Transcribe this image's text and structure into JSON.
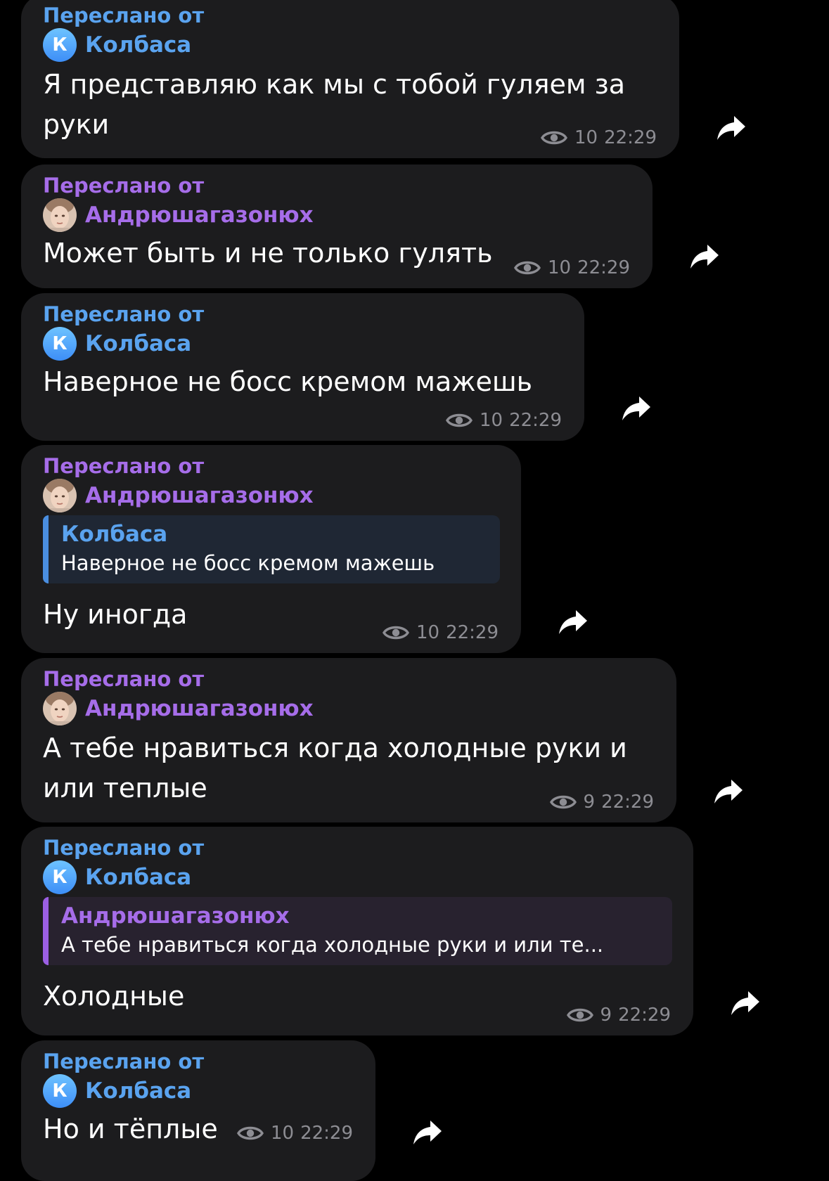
{
  "colors": {
    "background": "#000000",
    "bubble": "#1c1c1e",
    "blue_name": "#5aa3ef",
    "purple_name": "#a66de9",
    "meta": "#8d8d93"
  },
  "messages": [
    {
      "forward_label": "Переслано от",
      "sender": "Колбаса",
      "avatar_letter": "К",
      "text_lines": [
        "Я представляю как мы с тобой гуляем за",
        "руки"
      ],
      "views": "10",
      "time": "22:29"
    },
    {
      "forward_label": "Переслано от",
      "sender": "Андрюшагазонюх",
      "text_lines": [
        "Может быть и не только гулять"
      ],
      "views": "10",
      "time": "22:29"
    },
    {
      "forward_label": "Переслано от",
      "sender": "Колбаса",
      "avatar_letter": "К",
      "text_lines": [
        "Наверное не босс кремом мажешь"
      ],
      "views": "10",
      "time": "22:29"
    },
    {
      "forward_label": "Переслано от",
      "sender": "Андрюшагазонюх",
      "reply": {
        "name": "Колбаса",
        "text": "Наверное не босс кремом мажешь"
      },
      "text_lines": [
        "Ну иногда"
      ],
      "views": "10",
      "time": "22:29"
    },
    {
      "forward_label": "Переслано от",
      "sender": "Андрюшагазонюх",
      "text_lines": [
        "А тебе нравиться когда холодные руки и",
        "или теплые"
      ],
      "views": "9",
      "time": "22:29"
    },
    {
      "forward_label": "Переслано от",
      "sender": "Колбаса",
      "avatar_letter": "К",
      "reply": {
        "name": "Андрюшагазонюх",
        "text": "А тебе нравиться когда холодные руки и или те..."
      },
      "text_lines": [
        "Холодные"
      ],
      "views": "9",
      "time": "22:29"
    },
    {
      "forward_label": "Переслано от",
      "sender": "Колбаса",
      "avatar_letter": "К",
      "text_lines": [
        "Но и тёплые"
      ],
      "views": "10",
      "time": "22:29"
    }
  ]
}
